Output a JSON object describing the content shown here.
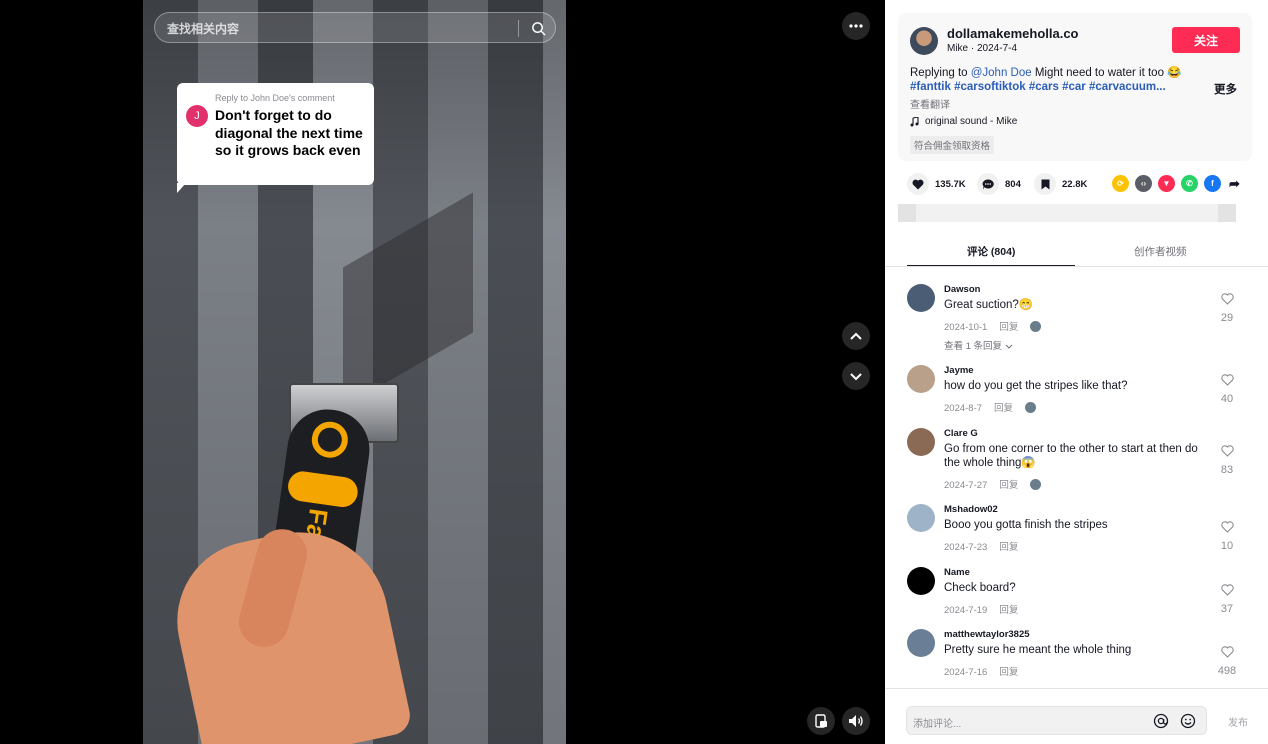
{
  "search": {
    "placeholder": "查找相关内容"
  },
  "reply_bubble": {
    "avatar_letter": "J",
    "label": "Reply to John Doe's comment",
    "text": "Don't forget to do diagonal the next time so it grows back even"
  },
  "video": {
    "brand_text": "Fanttik"
  },
  "author": {
    "name": "dollamakemeholla.co",
    "subtitle": "Mike · 2024-7-4",
    "follow_label": "关注"
  },
  "description": {
    "replying_prefix": "Replying to ",
    "mention": "@John Doe",
    "text": " Might need to water it too 😂",
    "hashtags": "#fanttik #carsoftiktok #cars #car #carvacuum...",
    "more_label": "更多",
    "translate_label": "查看翻译",
    "music": "original sound - Mike",
    "commission": "符合佣金领取资格"
  },
  "actions": {
    "likes": "135.7K",
    "comments": "804",
    "saves": "22.8K",
    "share_icons": [
      {
        "icon": "repost-icon",
        "color": "#fcc204"
      },
      {
        "icon": "embed-icon",
        "color": "#5b5e66"
      },
      {
        "icon": "send-icon",
        "color": "#fe2c55"
      },
      {
        "icon": "whatsapp-icon",
        "color": "#25d366"
      },
      {
        "icon": "facebook-icon",
        "color": "#1877f2"
      }
    ]
  },
  "tabs": {
    "comments": "评论 (804)",
    "creator_videos": "创作者视频"
  },
  "comments": [
    {
      "user": "Dawson",
      "text": "Great suction?😁",
      "date": "2024-10-1",
      "reply": "回复",
      "likes": "29",
      "view_replies": "查看 1 条回复",
      "avatar_color": "#4a5d75"
    },
    {
      "user": "Jayme",
      "text": "how do you get the stripes like that?",
      "date": "2024-8-7",
      "reply": "回复",
      "likes": "40",
      "avatar_color": "#b9a08a"
    },
    {
      "user": "Clare G",
      "text": "Go from one corner to the other to start at then do the whole thing😱",
      "date": "2024-7-27",
      "reply": "回复",
      "likes": "83",
      "avatar_color": "#8b6a55"
    },
    {
      "user": "Mshadow02",
      "text": "Booo you gotta finish the stripes",
      "date": "2024-7-23",
      "reply": "回复",
      "likes": "10",
      "avatar_color": "#9fb3c8"
    },
    {
      "user": "Name",
      "text": "Check board?",
      "date": "2024-7-19",
      "reply": "回复",
      "likes": "37",
      "avatar_color": "#000000"
    },
    {
      "user": "matthewtaylor3825",
      "text": "Pretty sure he meant the whole thing",
      "date": "2024-7-16",
      "reply": "回复",
      "likes": "498",
      "avatar_color": "#6a7f95"
    }
  ],
  "comment_bar": {
    "placeholder": "添加评论...",
    "post_label": "发布"
  },
  "colors": {
    "accent": "#fe2c55",
    "link": "#2b5db9"
  }
}
